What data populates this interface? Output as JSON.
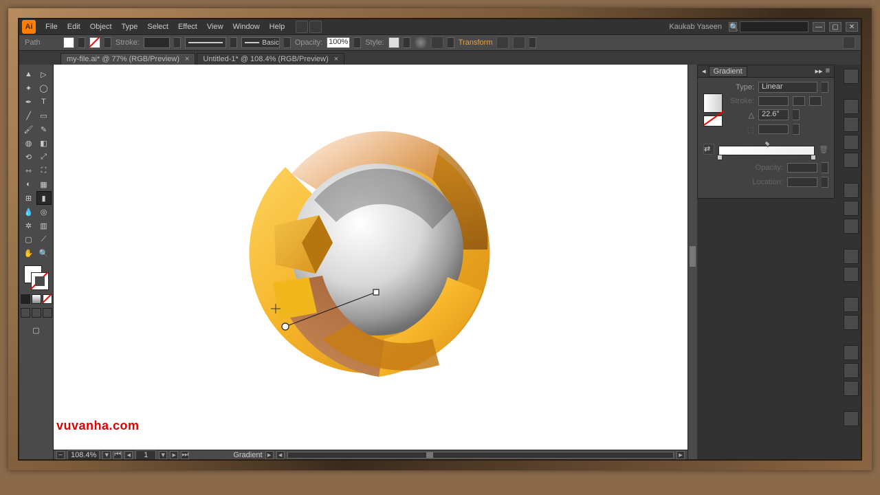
{
  "menu": {
    "file": "File",
    "edit": "Edit",
    "object": "Object",
    "type": "Type",
    "select": "Select",
    "effect": "Effect",
    "view": "View",
    "window": "Window",
    "help": "Help"
  },
  "user": "Kaukab Yaseen",
  "control": {
    "selection": "Path",
    "stroke": "Stroke:",
    "basic": "Basic",
    "opacity": "Opacity:",
    "opacity_val": "100%",
    "style": "Style:",
    "transform": "Transform"
  },
  "tabs": {
    "a": "my-file.ai* @ 77% (RGB/Preview)",
    "b": "Untitled-1* @ 108.4% (RGB/Preview)"
  },
  "gradient": {
    "title": "Gradient",
    "type_label": "Type:",
    "type_value": "Linear",
    "stroke_label": "Stroke:",
    "angle": "22.6°",
    "opacity_label": "Opacity:",
    "location_label": "Location:"
  },
  "status": {
    "zoom": "108.4%",
    "artboard": "1",
    "tool": "Gradient"
  },
  "watermark": "vuvanha.com"
}
